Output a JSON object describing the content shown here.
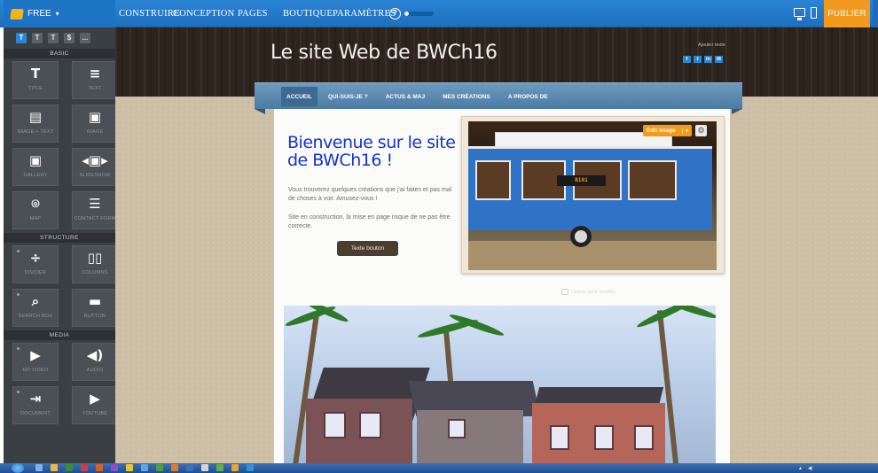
{
  "app": {
    "plan_label": "FREE"
  },
  "topnav": {
    "items": [
      "CONSTRUIRE",
      "CONCEPTION",
      "PAGES",
      "BOUTIQUE",
      "PARAMÈTRES"
    ],
    "publish_label": "PUBLIER",
    "progress": 0.15
  },
  "sidebar": {
    "tools": [
      "T",
      "T",
      "T",
      "$",
      "..."
    ],
    "sections": [
      {
        "title": "BASIC",
        "items": [
          {
            "label": "TITLE",
            "icon": "title-icon",
            "glyph": "T"
          },
          {
            "label": "TEXT",
            "icon": "text-icon",
            "glyph": "≡"
          },
          {
            "label": "IMAGE + TEXT",
            "icon": "image-text-icon",
            "glyph": "▤"
          },
          {
            "label": "IMAGE",
            "icon": "image-icon",
            "glyph": "▣"
          },
          {
            "label": "GALLERY",
            "icon": "gallery-icon",
            "glyph": "▣"
          },
          {
            "label": "SLIDESHOW",
            "icon": "slideshow-icon",
            "glyph": "◂▣▸"
          },
          {
            "label": "MAP",
            "icon": "map-icon",
            "glyph": "⌾"
          },
          {
            "label": "CONTACT FORM",
            "icon": "contact-form-icon",
            "glyph": "☰"
          }
        ]
      },
      {
        "title": "STRUCTURE",
        "items": [
          {
            "label": "DIVIDER",
            "icon": "divider-icon",
            "glyph": "÷"
          },
          {
            "label": "COLUMNS",
            "icon": "columns-icon",
            "glyph": "▯▯"
          },
          {
            "label": "SEARCH BOX",
            "icon": "search-box-icon",
            "glyph": "⌕"
          },
          {
            "label": "BUTTON",
            "icon": "button-icon",
            "glyph": "▬"
          }
        ]
      },
      {
        "title": "MEDIA",
        "items": [
          {
            "label": "HD VIDEO",
            "icon": "hd-video-icon",
            "glyph": "▶"
          },
          {
            "label": "AUDIO",
            "icon": "audio-icon",
            "glyph": "◀)"
          },
          {
            "label": "DOCUMENT",
            "icon": "document-icon",
            "glyph": "⇥"
          },
          {
            "label": "YOUTUBE",
            "icon": "youtube-icon",
            "glyph": "▶"
          }
        ]
      }
    ]
  },
  "site": {
    "title": "Le site Web de BWCh16",
    "add_text": "Ajouter texte",
    "social": [
      "f",
      "t",
      "in",
      "✉"
    ],
    "nav": [
      "ACCUEIL",
      "QUI-SUIS-JE ?",
      "ACTUS & MAJ",
      "MES CRÉATIONS",
      "A PROPOS DE"
    ],
    "hero_title": "Bienvenue sur le site de BWCh16 !",
    "hero_text1": "Vous trouverez quelques créations que j'ai faites et pas mal de choses à voir. Amusez-vous !",
    "hero_text2": "Site en construction, la mise en page risque de ne pas être correcte.",
    "button_label": "Texte bouton",
    "edit_image_label": "Edit Image",
    "bus_sign": "B101",
    "caption": "Cliquer pour modifier"
  },
  "colors": {
    "accent": "#2a84d4",
    "publish": "#f29a1e",
    "heading": "#1534c9"
  }
}
